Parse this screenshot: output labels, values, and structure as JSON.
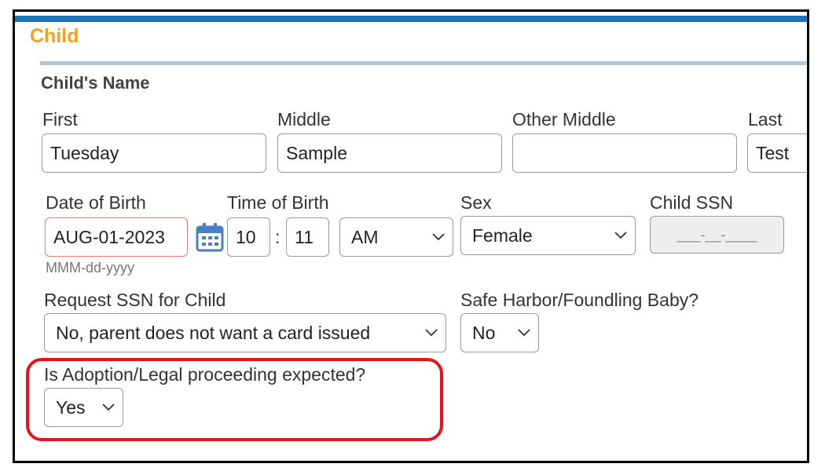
{
  "section": {
    "title": "Child"
  },
  "child_name": {
    "heading": "Child's Name",
    "first": {
      "label": "First",
      "value": "Tuesday"
    },
    "middle": {
      "label": "Middle",
      "value": "Sample"
    },
    "other_middle": {
      "label": "Other Middle",
      "value": ""
    },
    "last": {
      "label": "Last",
      "value": "Test"
    }
  },
  "birth": {
    "dob_label": "Date of Birth",
    "dob_value": "AUG-01-2023",
    "dob_hint": "MMM-dd-yyyy",
    "tob_label": "Time of Birth",
    "hour": "10",
    "separator": ":",
    "minute": "11",
    "ampm": "AM",
    "sex_label": "Sex",
    "sex_value": "Female",
    "ssn_label": "Child SSN",
    "ssn_value": "___-__-____"
  },
  "request_ssn": {
    "label": "Request SSN for Child",
    "value": "No, parent does not want a card issued"
  },
  "safe_harbor": {
    "label": "Safe Harbor/Foundling Baby?",
    "value": "No"
  },
  "adoption": {
    "label": "Is Adoption/Legal proceeding expected?",
    "value": "Yes"
  },
  "colors": {
    "accent_blue": "#1b75bb",
    "section_title": "#f4a21c",
    "highlight_red": "#e3141b",
    "calendar_icon": "#4a7fc1"
  },
  "icons": [
    "calendar-icon",
    "chevron-down-icon"
  ]
}
